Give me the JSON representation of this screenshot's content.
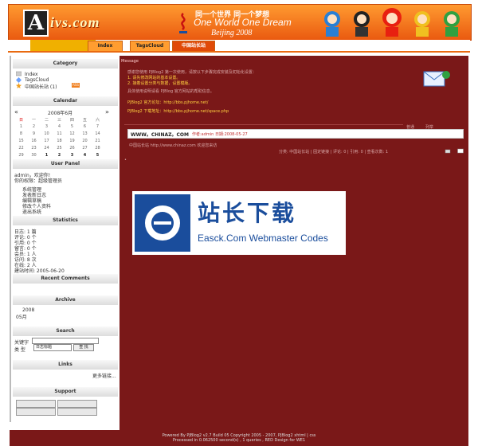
{
  "header": {
    "logo_letter": "A",
    "logo_brand": "ivs.com",
    "slogan_cn": "同一个世界 同一个梦想",
    "slogan_en": "One World One Dream",
    "beijing": "Beijing 2008"
  },
  "nav": {
    "items": [
      "Index",
      "TagsCloud",
      "中国站长站"
    ]
  },
  "sidebar": {
    "category": {
      "title": "Category",
      "items": [
        "Index",
        "TagsCloud",
        "中国站长站 (1)"
      ]
    },
    "calendar": {
      "title": "Calendar",
      "month": "2008年6月",
      "weekdays": [
        "日",
        "一",
        "二",
        "三",
        "四",
        "五",
        "六"
      ],
      "rows": [
        [
          "1",
          "2",
          "3",
          "4",
          "5",
          "6",
          "7"
        ],
        [
          "8",
          "9",
          "10",
          "11",
          "12",
          "13",
          "14"
        ],
        [
          "15",
          "16",
          "17",
          "18",
          "19",
          "20",
          "21"
        ],
        [
          "22",
          "23",
          "24",
          "25",
          "26",
          "27",
          "28"
        ],
        [
          "29",
          "30",
          "1",
          "2",
          "3",
          "4",
          "5"
        ]
      ]
    },
    "user_panel": {
      "title": "User Panel",
      "greeting": "admin，欢迎你!",
      "role": "你的权限：超级管理员",
      "links": [
        "系统管理",
        "发表新日志",
        "编辑草稿",
        "修改个人资料",
        "退出系统"
      ]
    },
    "statistics": {
      "title": "Statistics",
      "lines": [
        "日志: 1 篇",
        "评论: 0 个",
        "引用: 0 个",
        "留言: 0 个",
        "会员: 1 人",
        "访问: 8 次",
        "在线: 2 人",
        "建站时间: 2005-06-20"
      ]
    },
    "recent_comments": {
      "title": "Recent Comments"
    },
    "archive": {
      "title": "Archive",
      "year": "2008",
      "month": "05月"
    },
    "search": {
      "title": "Search",
      "keyword_label": "关键字",
      "type_label": "类 型",
      "type_value": "日志标题",
      "button": "查 找"
    },
    "links": {
      "title": "Links",
      "more": "更多链接..."
    },
    "support": {
      "title": "Support"
    }
  },
  "main": {
    "heading": "Message",
    "lines": [
      "感谢您使用 PJBlog2 第一次使用，请按以下步骤完成安装及初始化设置：",
      "1. 请先修改网站的基本设置。",
      "2. 接着设置分类与数据，设置模版。",
      "具体使用说明请看 PJBlog 官方网站的帮助信息。"
    ],
    "links": [
      "PJBlog2 官方论坛：http://bbs.pjhome.net/",
      "PJBlog2 下载地址：http://bbs.pjhome.net/space.php"
    ],
    "entry_title": "WWW。CHINAZ。COM",
    "entry_meta": "作者:admin 日期:2008-05-27",
    "entry_body": "中国站长站 http://www.chinaz.com 欢迎您来访",
    "entry_footer": "分类: 中国站长站 | 固定链接 | 评论: 0 | 引用: 0 | 查看次数: 1",
    "sidebar_tags": [
      "普通",
      "列举"
    ]
  },
  "banner": {
    "cn": "站长下载",
    "en": "Easck.Com Webmaster Codes"
  },
  "footer": {
    "line1": "Powered By PJBlog2 v2.7 Build 05 Copyright 2005 - 2007, PJBlog2 xhtml | css",
    "line2": "Processed in 0.062500 second(s) , 1 queries , RED Design for WE1"
  }
}
